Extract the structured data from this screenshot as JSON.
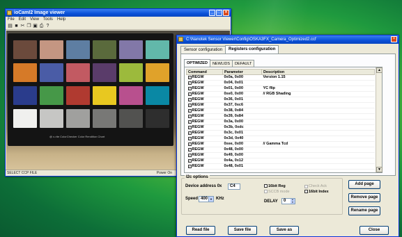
{
  "image_viewer": {
    "title": "ioCamI2 Image viewer",
    "menu": [
      "File",
      "Edit",
      "View",
      "Tools",
      "Help"
    ],
    "status": "SELECT CCP FILE",
    "status_right": "Power On",
    "chart_caption": "@ x-rite  ColorChecker  Color Rendition Chart",
    "patch_colors": [
      [
        "#6b4a3c",
        "#c49682",
        "#5e7ea2",
        "#5a6a3c",
        "#8278a8",
        "#62b8aa"
      ],
      [
        "#d67a28",
        "#4a5ca6",
        "#c25a62",
        "#5a3c6a",
        "#9cba3c",
        "#e0a22a"
      ],
      [
        "#2a3c8c",
        "#469848",
        "#b03a30",
        "#e8c820",
        "#b8508e",
        "#0a88a4"
      ],
      [
        "#f0f0ee",
        "#c6c6c4",
        "#a0a09e",
        "#787876",
        "#525250",
        "#2e2e2e"
      ]
    ]
  },
  "dialog": {
    "title": "C:\\Nanotek Sensor Viewer\\Config\\OSKA3FX_Camera_Optimized2.ccf",
    "tabs": [
      "Sensor configuration",
      "Registers configuration"
    ],
    "inner_tabs": [
      "OPTIMIZED",
      "NEWLIDS",
      "DEFAULT"
    ],
    "table": {
      "headers": [
        "Command",
        "Parameter",
        "Description"
      ],
      "rows": [
        [
          "REGW",
          "0x0a, 0x00",
          "Version 1.15"
        ],
        [
          "REGW",
          "0x04, 0x01",
          ""
        ],
        [
          "REGW",
          "0x01, 0x00",
          "YC flip"
        ],
        [
          "REGW",
          "0xe0, 0x00",
          "// RGB Shading"
        ],
        [
          "REGW",
          "0x36, 0x01",
          ""
        ],
        [
          "REGW",
          "0x37, 0xc6",
          ""
        ],
        [
          "REGW",
          "0x38, 0x84",
          ""
        ],
        [
          "REGW",
          "0x39, 0x84",
          ""
        ],
        [
          "REGW",
          "0x3a, 0x00",
          ""
        ],
        [
          "REGW",
          "0x3b, 0xdc",
          ""
        ],
        [
          "REGW",
          "0x3c, 0x01",
          ""
        ],
        [
          "REGW",
          "0x3d, 0x40",
          ""
        ],
        [
          "REGW",
          "0xee, 0x00",
          "// Gamma Tcd"
        ],
        [
          "REGW",
          "0x48, 0x00",
          ""
        ],
        [
          "REGW",
          "0x49, 0x00",
          ""
        ],
        [
          "REGW",
          "0x4a, 0x12",
          ""
        ],
        [
          "REGW",
          "0x48, 0x01",
          ""
        ]
      ]
    },
    "i2c": {
      "legend": "I2c options",
      "device_label": "Device address 0x",
      "device_value": "C4",
      "speed_label": "Speed",
      "speed_value": "400",
      "speed_unit": "KHz",
      "chk_16bit_reg": "16bit Reg",
      "chk_sccb": "SCCB mode",
      "chk_check_ack": "Check Ack",
      "chk_16bit_index": "16bit Index",
      "delay_label": "DELAY",
      "delay_value": "0"
    },
    "buttons": {
      "add_page": "Add page",
      "remove_page": "Remove page",
      "rename_page": "Rename page",
      "read_file": "Read file",
      "save_file": "Save file",
      "save_as": "Save as",
      "close": "Close"
    }
  }
}
